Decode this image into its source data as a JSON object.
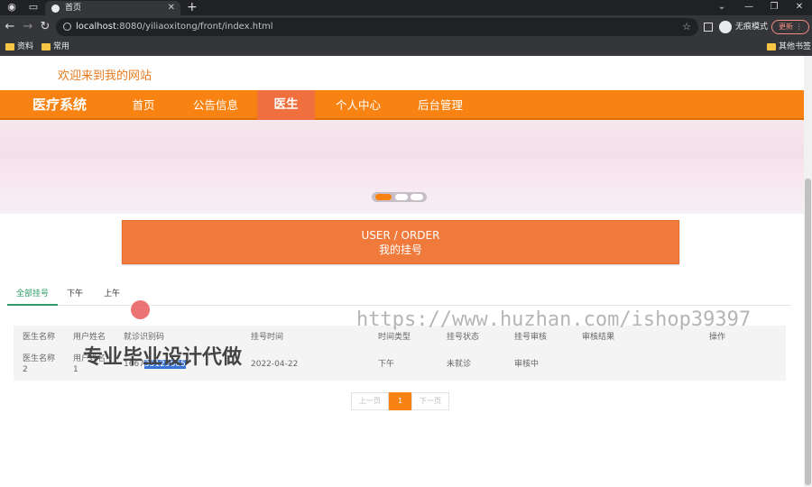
{
  "browser": {
    "tab_title": "首页",
    "url_host": "localhost",
    "url_path": ":8080/yiliaoxitong/front/index.html",
    "incognito_label": "无痕模式",
    "update_label": "更新",
    "bookmarks": [
      "资料",
      "常用"
    ],
    "other_bookmarks": "其他书签"
  },
  "site": {
    "welcome": "欢迎来到我的网站",
    "brand": "医疗系统",
    "nav": [
      "首页",
      "公告信息",
      "医生",
      "个人中心",
      "后台管理"
    ],
    "active_nav": "医生"
  },
  "section": {
    "title_en": "USER / ORDER",
    "title_cn": "我的挂号"
  },
  "filter_tabs": [
    "全部挂号",
    "下午",
    "上午"
  ],
  "table": {
    "headers": [
      "医生名称",
      "用户姓名",
      "就诊识别码",
      "挂号时间",
      "时间类型",
      "挂号状态",
      "挂号审核",
      "审核结果",
      "操作"
    ],
    "row": {
      "doctor": "医生名称\n2",
      "doctor_l1": "医生名称",
      "doctor_l2": "2",
      "user_l1": "用户姓名",
      "user_l2": "1",
      "code_prefix": "1667",
      "code_selected": "35125665",
      "time": "2022-04-22",
      "time_type": "下午",
      "status": "未就诊",
      "review": "审核中",
      "result": "",
      "action": ""
    }
  },
  "pager": {
    "prev": "上一页",
    "page": "1",
    "next": "下一页"
  },
  "watermarks": {
    "url": "https://www.huzhan.com/ishop39397",
    "promo": "专业毕业设计代做"
  }
}
